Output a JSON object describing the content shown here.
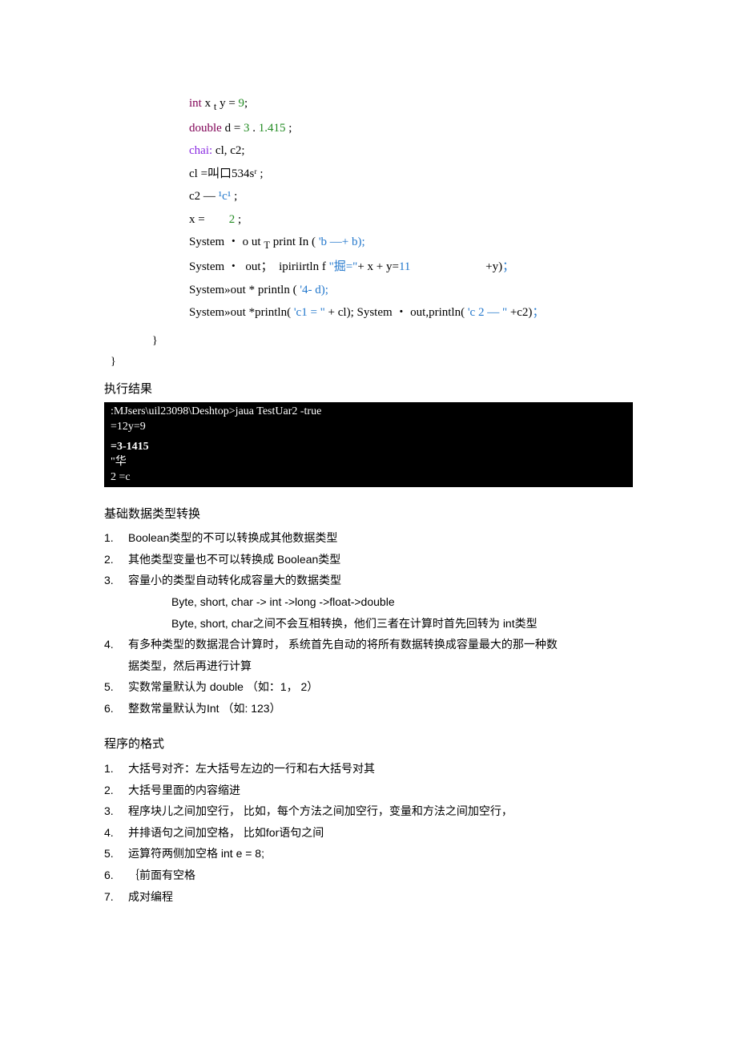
{
  "code": {
    "l1_a": "int",
    "l1_b": " x ",
    "l1_c": "t",
    "l1_d": " y = ",
    "l1_e": "9",
    "l1_f": ";",
    "l2_a": "double",
    "l2_b": " d = ",
    "l2_c": "3",
    "l2_d": " . ",
    "l2_e": "1.415",
    "l2_f": " ;",
    "l3_a": "chai:",
    "l3_b": " cl, c2;",
    "l4": "cl =叫口534sʳ ;",
    "l5_a": "c2 — ",
    "l5_b": "¹c¹",
    "l5_c": " ;",
    "l6_a": "x =        ",
    "l6_b": "2",
    "l6_c": " ;",
    "l7_a": "System ・ o ut ",
    "l7_b": "T",
    "l7_c": " print In ( ",
    "l7_d": "'b —+ b);",
    "l8_a": "System ・  out；  ipiriirtln f ",
    "l8_b": "\"掘=\"",
    "l8_c": "+ x + y=",
    "l8_d": "11",
    "l8_e": "                         +y)",
    "l8_f": "；",
    "l9_a": "System»out * println ( ",
    "l9_b": "'4- d);",
    "l10_a": "System»out *println( ",
    "l10_b": "'c1 = \"",
    "l10_c": " + cl); System ・ out,println( ",
    "l10_d": "'c 2 — \"",
    "l10_e": " +c2)",
    "l10_f": "；",
    "brace1": "}",
    "brace2": "}"
  },
  "exec_label": "执行结果",
  "terminal": {
    "r1": ":MJsers\\uil23098\\Deshtop>jaua TestUar2 -true",
    "r2": "=12y=9",
    "r3": "=3-1415",
    "r4": "\"华",
    "r5": "2 =c"
  },
  "section1_title": "基础数据类型转换",
  "list1": {
    "i1": "Boolean类型的不可以转换成其他数据类型",
    "i2": "其他类型变量也不可以转换成          Boolean类型",
    "i3": "容量小的类型自动转化成容量大的数据类型",
    "i3s1": "Byte, short, char -> int ->long ->float->double",
    "i3s2": "Byte, short, char之间不会互相转换，他们三者在计算时首先回转为               int类型",
    "i4a": "有多种类型的数据混合计算时，          系统首先自动的将所有数据转换成容量最大的那一种数",
    "i4b": "据类型，然后再进行计算",
    "i5": "实数常量默认为  double （如：1，        2）",
    "i6": "整数常量默认为Int （如:  123）"
  },
  "section2_title": "程序的格式",
  "list2": {
    "i1": "大括号对齐：左大括号左边的一行和右大括号对其",
    "i2": "大括号里面的内容缩进",
    "i3": "程序块儿之间加空行，          比如，每个方法之间加空行，变量和方法之间加空行，",
    "i4": "并排语句之间加空格，       比如for语句之间",
    "i5": "运算符两侧加空格       int e = 8;",
    "i6": "｛前面有空格",
    "i7": "成对编程"
  }
}
